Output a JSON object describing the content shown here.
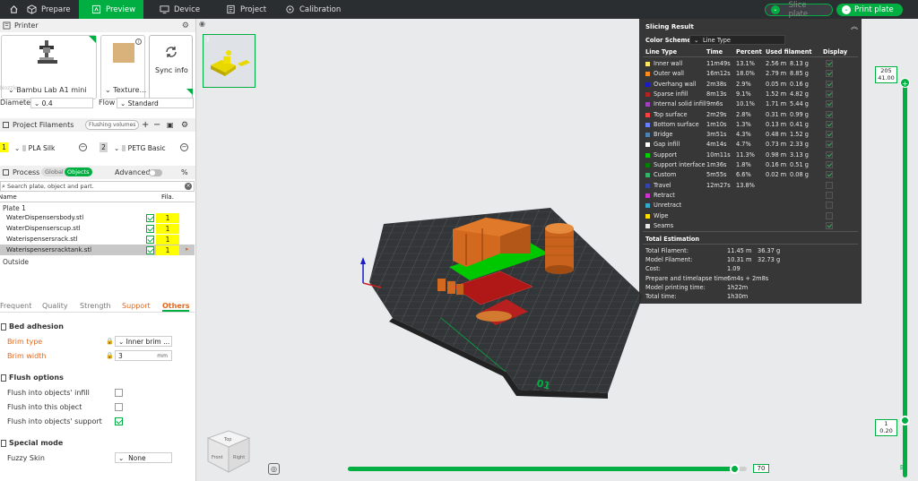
{
  "topbar": {
    "tabs": [
      {
        "label": "Prepare"
      },
      {
        "label": "Preview"
      },
      {
        "label": "Device"
      },
      {
        "label": "Project"
      },
      {
        "label": "Calibration"
      }
    ],
    "slice_plate": "Slice plate",
    "print_plate": "Print plate"
  },
  "printer": {
    "section_title": "Printer",
    "printer_name": "Bambu Lab A1 mini",
    "plate_label": "Texture...",
    "sync_label": "Sync info",
    "nozzle_label": "Nozzle",
    "diameter_label": "Diameter",
    "diameter_value": "0.4",
    "flow_label": "Flow",
    "flow_value": "Standard"
  },
  "filaments": {
    "section_title": "Project Filaments",
    "flushing_label": "Flushing volumes",
    "items": [
      {
        "index": "1",
        "name": "PLA Silk",
        "color": "#ffff00"
      },
      {
        "index": "2",
        "name": "PETG Basic",
        "color": "#e0e0e0"
      }
    ]
  },
  "process": {
    "section_title": "Process",
    "global_label": "Global",
    "objects_label": "Objects",
    "advanced_label": "Advanced",
    "search_placeholder": "Search plate, object and part.",
    "col_name": "Name",
    "col_fila": "Fila.",
    "plate_label": "Plate 1",
    "objects": [
      {
        "name": "WaterDispensersbody.stl",
        "fila": "1"
      },
      {
        "name": "WaterDispenserscup.stl",
        "fila": "1"
      },
      {
        "name": "Waterispensersrack.stl",
        "fila": "1"
      },
      {
        "name": "Waterispensersracktank.stl",
        "fila": "1"
      }
    ],
    "outside_label": "Outside"
  },
  "settings_tabs": [
    {
      "label": "Frequent"
    },
    {
      "label": "Quality"
    },
    {
      "label": "Strength"
    },
    {
      "label": "Support"
    },
    {
      "label": "Others"
    }
  ],
  "bed_adhesion": {
    "title": "Bed adhesion",
    "brim_type_label": "Brim type",
    "brim_type_value": "Inner brim ...",
    "brim_width_label": "Brim width",
    "brim_width_value": "3",
    "brim_width_unit": "mm"
  },
  "flush_options": {
    "title": "Flush options",
    "items": [
      {
        "label": "Flush into objects' infill",
        "checked": false
      },
      {
        "label": "Flush into this object",
        "checked": false
      },
      {
        "label": "Flush into objects' support",
        "checked": true
      }
    ]
  },
  "special_mode": {
    "title": "Special mode",
    "fuzzy_label": "Fuzzy Skin",
    "fuzzy_value": "None"
  },
  "slicing_result": {
    "title": "Slicing Result",
    "color_scheme_label": "Color Scheme",
    "color_scheme_value": "Line Type",
    "columns": [
      "Line Type",
      "Time",
      "Percent",
      "Used filament",
      "Display"
    ],
    "rows": [
      {
        "name": "Inner wall",
        "color": "#ffe566",
        "time": "11m49s",
        "percent": "13.1%",
        "len": "2.56 m",
        "weight": "8.13 g",
        "display": true
      },
      {
        "name": "Outer wall",
        "color": "#ff8c1a",
        "time": "16m12s",
        "percent": "18.0%",
        "len": "2.79 m",
        "weight": "8.85 g",
        "display": true
      },
      {
        "name": "Overhang wall",
        "color": "#1a1acc",
        "time": "2m38s",
        "percent": "2.9%",
        "len": "0.05 m",
        "weight": "0.16 g",
        "display": true
      },
      {
        "name": "Sparse infill",
        "color": "#b22222",
        "time": "8m13s",
        "percent": "9.1%",
        "len": "1.52 m",
        "weight": "4.82 g",
        "display": true
      },
      {
        "name": "Internal solid infill",
        "color": "#a040c0",
        "time": "9m6s",
        "percent": "10.1%",
        "len": "1.71 m",
        "weight": "5.44 g",
        "display": true
      },
      {
        "name": "Top surface",
        "color": "#ff4040",
        "time": "2m29s",
        "percent": "2.8%",
        "len": "0.31 m",
        "weight": "0.99 g",
        "display": true
      },
      {
        "name": "Bottom surface",
        "color": "#6680ff",
        "time": "1m10s",
        "percent": "1.3%",
        "len": "0.13 m",
        "weight": "0.41 g",
        "display": true
      },
      {
        "name": "Bridge",
        "color": "#4d80b3",
        "time": "3m51s",
        "percent": "4.3%",
        "len": "0.48 m",
        "weight": "1.52 g",
        "display": true
      },
      {
        "name": "Gap infill",
        "color": "#ffffff",
        "time": "4m14s",
        "percent": "4.7%",
        "len": "0.73 m",
        "weight": "2.33 g",
        "display": true
      },
      {
        "name": "Support",
        "color": "#00d000",
        "time": "10m11s",
        "percent": "11.3%",
        "len": "0.98 m",
        "weight": "3.13 g",
        "display": true
      },
      {
        "name": "Support interface",
        "color": "#008000",
        "time": "1m36s",
        "percent": "1.8%",
        "len": "0.16 m",
        "weight": "0.51 g",
        "display": true
      },
      {
        "name": "Custom",
        "color": "#33b366",
        "time": "5m55s",
        "percent": "6.6%",
        "len": "0.02 m",
        "weight": "0.08 g",
        "display": true
      },
      {
        "name": "Travel",
        "color": "#3344aa",
        "time": "12m27s",
        "percent": "13.8%",
        "len": "",
        "weight": "",
        "display": false
      },
      {
        "name": "Retract",
        "color": "#cc33cc",
        "time": "",
        "percent": "",
        "len": "",
        "weight": "",
        "display": false
      },
      {
        "name": "Unretract",
        "color": "#33aacc",
        "time": "",
        "percent": "",
        "len": "",
        "weight": "",
        "display": false
      },
      {
        "name": "Wipe",
        "color": "#ffe000",
        "time": "",
        "percent": "",
        "len": "",
        "weight": "",
        "display": false
      },
      {
        "name": "Seams",
        "color": "#e6e6e6",
        "time": "",
        "percent": "",
        "len": "",
        "weight": "",
        "display": true
      }
    ],
    "total_title": "Total Estimation",
    "totals": [
      {
        "label": "Total Filament:",
        "v1": "11.45 m",
        "v2": "36.37 g"
      },
      {
        "label": "Model Filament:",
        "v1": "10.31 m",
        "v2": "32.73 g"
      },
      {
        "label": "Cost:",
        "v1": "1.09",
        "v2": ""
      },
      {
        "label": "Prepare and timelapse time:",
        "v1": "6m4s + 2m8s",
        "v2": ""
      },
      {
        "label": "Model printing time:",
        "v1": "1h22m",
        "v2": ""
      },
      {
        "label": "Total time:",
        "v1": "1h30m",
        "v2": ""
      }
    ]
  },
  "layer_slider": {
    "top_value": "205",
    "top_height": "41.00",
    "bottom_value": "1",
    "bottom_height": "0.20"
  },
  "move_slider": {
    "value": "70",
    "fraction": 0.97
  },
  "plate_number": "01",
  "view_cube": {
    "top": "Top",
    "front": "Front",
    "right": "Right"
  },
  "colors": {
    "accent": "#00ae42",
    "topbar": "#2b2e31",
    "model": "#d2691e"
  }
}
